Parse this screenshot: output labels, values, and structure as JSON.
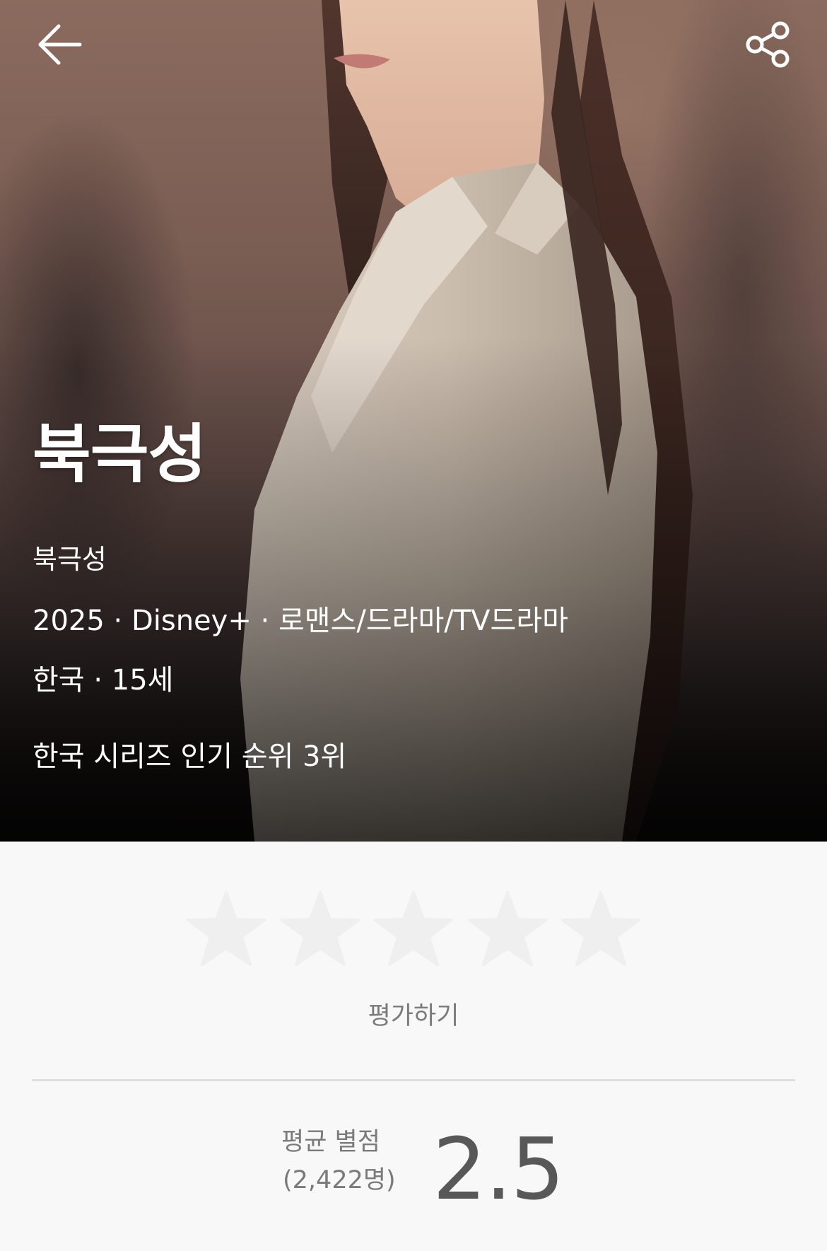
{
  "hero": {
    "title": "북극성",
    "subtitle": "북극성",
    "meta_line_1": "2025 · Disney+ · 로맨스/드라마/TV드라마",
    "meta_line_2": "한국 · 15세",
    "ranking": "한국 시리즈 인기 순위 3위"
  },
  "toolbar": {
    "back_icon": "back-arrow-icon",
    "share_icon": "share-icon"
  },
  "rating": {
    "stars_total": 5,
    "user_rating": 0,
    "rate_label": "평가하기",
    "average_label": "평균 별점",
    "average_count": "(2,422명)",
    "average_value": "2.5"
  },
  "colors": {
    "star_empty": "#efefef",
    "background": "#f8f8f8",
    "divider": "#dedede",
    "muted_text": "#7a7a7a",
    "average_text": "#585858"
  }
}
